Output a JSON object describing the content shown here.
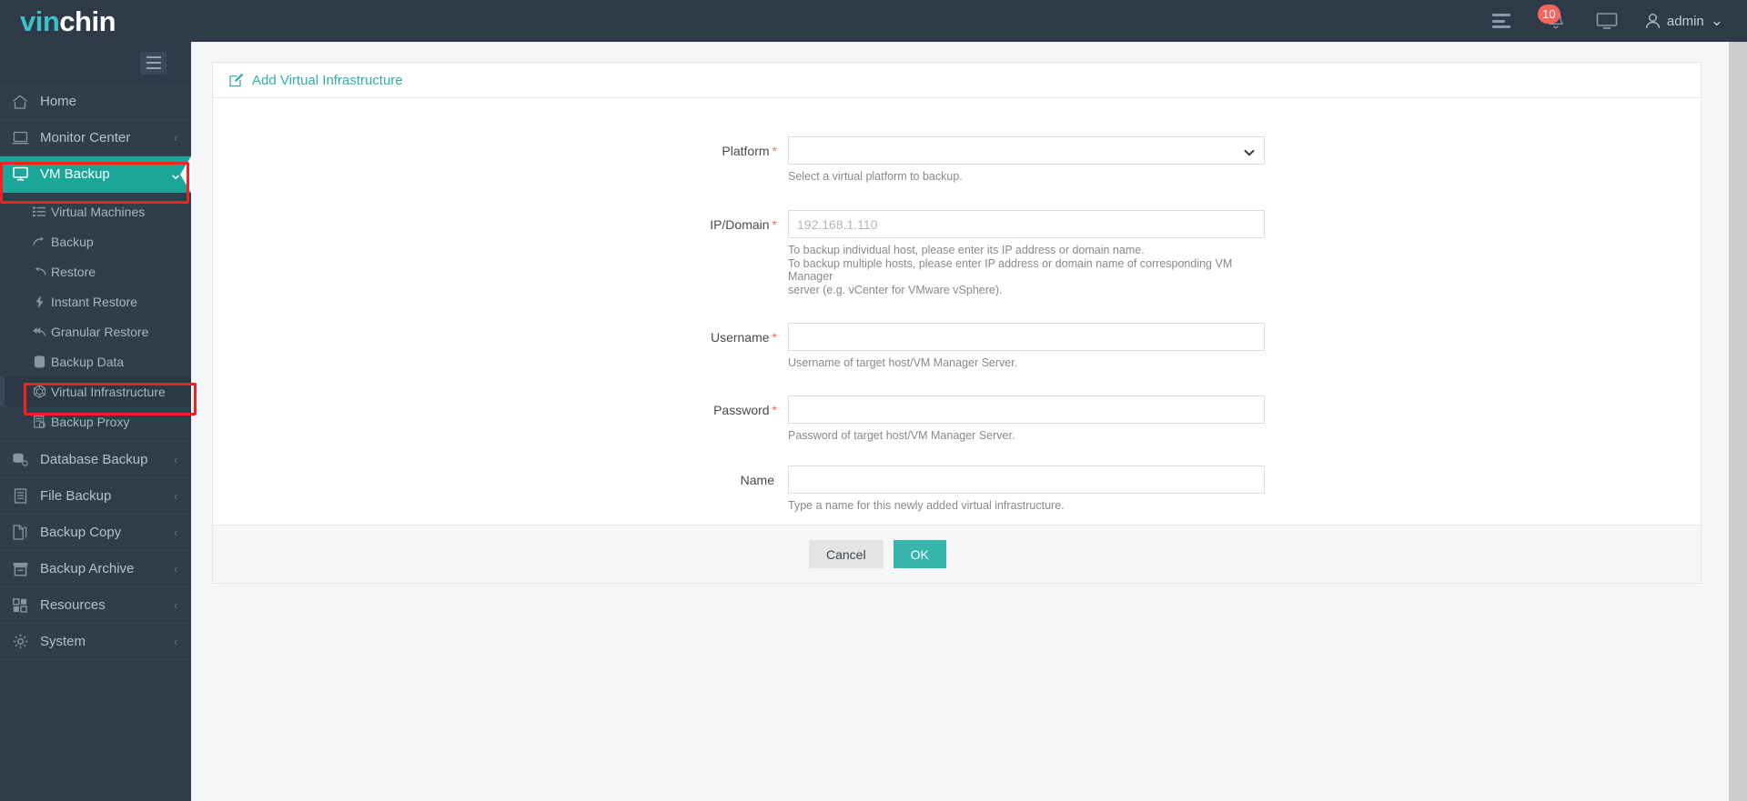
{
  "brand": {
    "part1": "vin",
    "part2": "chin"
  },
  "topbar": {
    "list_icon": "list-icon",
    "notification_count": "10",
    "bell_icon": "bell-icon",
    "monitor_icon": "monitor-icon",
    "user_icon": "user-icon",
    "username": "admin",
    "chevron": "⌄"
  },
  "sidebar": {
    "toggle": "hamburger-toggle",
    "items": [
      {
        "label": "Home",
        "icon": "home-icon",
        "arrow": "",
        "active": false
      },
      {
        "label": "Monitor Center",
        "icon": "monitor-icon",
        "arrow": "‹",
        "active": false
      },
      {
        "label": "VM Backup",
        "icon": "desktop-icon",
        "arrow": "⌄",
        "active": true
      }
    ],
    "submenu": [
      {
        "label": "Virtual Machines",
        "icon": "list-icon",
        "active": false
      },
      {
        "label": "Backup",
        "icon": "arrow-right-icon",
        "active": false
      },
      {
        "label": "Restore",
        "icon": "arrow-left-icon",
        "active": false
      },
      {
        "label": "Instant Restore",
        "icon": "bolt-icon",
        "active": false
      },
      {
        "label": "Granular Restore",
        "icon": "reply-all-icon",
        "active": false
      },
      {
        "label": "Backup Data",
        "icon": "database-icon",
        "active": false
      },
      {
        "label": "Virtual Infrastructure",
        "icon": "cube-icon",
        "active": true
      },
      {
        "label": "Backup Proxy",
        "icon": "server-icon",
        "active": false
      }
    ],
    "items_lower": [
      {
        "label": "Database Backup",
        "icon": "database-stack-icon",
        "arrow": "‹"
      },
      {
        "label": "File Backup",
        "icon": "file-icon",
        "arrow": "‹"
      },
      {
        "label": "Backup Copy",
        "icon": "copy-icon",
        "arrow": "‹"
      },
      {
        "label": "Backup Archive",
        "icon": "archive-icon",
        "arrow": "‹"
      },
      {
        "label": "Resources",
        "icon": "grid-icon",
        "arrow": "‹"
      },
      {
        "label": "System",
        "icon": "gear-icon",
        "arrow": "‹"
      }
    ]
  },
  "page": {
    "title": "Add Virtual Infrastructure",
    "title_icon": "edit-square-icon"
  },
  "form": {
    "platform": {
      "label": "Platform",
      "required": "*",
      "value": "",
      "hint": "Select a virtual platform to backup."
    },
    "ip_domain": {
      "label": "IP/Domain",
      "required": "*",
      "value": "",
      "placeholder": "192.168.1.110",
      "hint_line1": "To backup individual host, please enter its IP address or domain name.",
      "hint_line2": "To backup multiple hosts, please enter IP address or domain name of corresponding VM Manager",
      "hint_line3": "server (e.g. vCenter for VMware vSphere)."
    },
    "username": {
      "label": "Username",
      "required": "*",
      "value": "",
      "hint": "Username of target host/VM Manager Server."
    },
    "password": {
      "label": "Password",
      "required": "*",
      "value": "",
      "hint": "Password of target host/VM Manager Server."
    },
    "name": {
      "label": "Name",
      "required": "",
      "value": "",
      "hint": "Type a name for this newly added virtual infrastructure."
    }
  },
  "footer": {
    "cancel_label": "Cancel",
    "ok_label": "OK"
  },
  "colors": {
    "accent_teal": "#1aa79a",
    "button_teal": "#37b5ad",
    "title_teal": "#2fb0a8",
    "sidebar_bg": "#323d4c",
    "topbar_bg": "#2e3a48",
    "badge_red": "#f5655b",
    "annotation_red": "#fb1e1e",
    "required_red": "#ea6a67"
  }
}
